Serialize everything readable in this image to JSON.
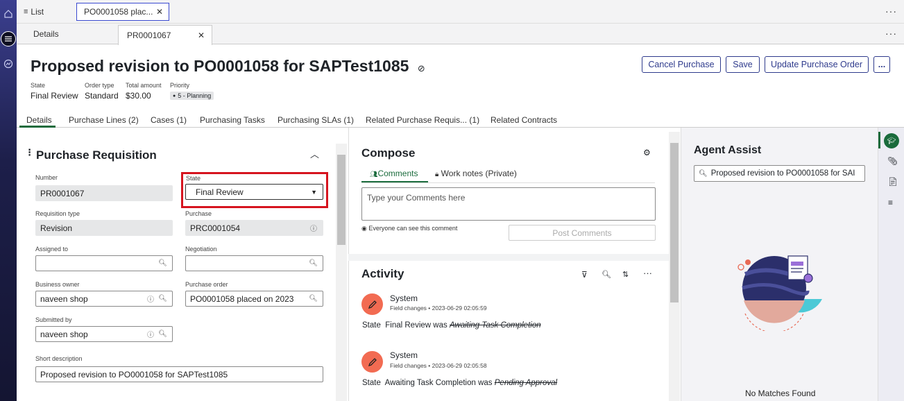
{
  "rail": {
    "icons": [
      "home-icon",
      "list-icon",
      "analytics-icon"
    ]
  },
  "top_tabs": {
    "list_label": "List",
    "record_tab": "PO0001058 plac..."
  },
  "sub_tabs": {
    "details": "Details",
    "record": "PR0001067"
  },
  "header": {
    "title": "Proposed revision to PO0001058 for SAPTest1085",
    "buttons": {
      "cancel": "Cancel Purchase",
      "save": "Save",
      "update": "Update Purchase Order",
      "more": "..."
    },
    "meta": [
      {
        "label": "State",
        "value": "Final Review"
      },
      {
        "label": "Order type",
        "value": "Standard"
      },
      {
        "label": "Total amount",
        "value": "$30.00"
      },
      {
        "label": "Priority",
        "value": "5 - Planning"
      }
    ]
  },
  "form_tabs": [
    "Details",
    "Purchase Lines (2)",
    "Cases (1)",
    "Purchasing Tasks",
    "Purchasing SLAs (1)",
    "Related Purchase Requis... (1)",
    "Related Contracts"
  ],
  "form": {
    "section_title": "Purchase Requisition",
    "number_label": "Number",
    "number": "PR0001067",
    "state_label": "State",
    "state": "Final Review",
    "req_type_label": "Requisition type",
    "req_type": "Revision",
    "purchase_label": "Purchase",
    "purchase": "PRC0001054",
    "assigned_label": "Assigned to",
    "assigned": "",
    "negotiation_label": "Negotiation",
    "negotiation": "",
    "owner_label": "Business owner",
    "owner": "naveen shop",
    "po_label": "Purchase order",
    "po": "PO0001058 placed on 2023",
    "submitted_label": "Submitted by",
    "submitted": "naveen shop",
    "short_desc_label": "Short description",
    "short_desc": "Proposed revision to PO0001058 for SAPTest1085"
  },
  "compose": {
    "title": "Compose",
    "tab_comments": "Comments",
    "tab_worknotes": "Work notes (Private)",
    "placeholder": "Type your Comments here",
    "visibility": "Everyone can see this comment",
    "post": "Post Comments"
  },
  "activity": {
    "title": "Activity",
    "entries": [
      {
        "author": "System",
        "meta": "Field changes • 2023-06-29 02:05:59",
        "field": "State",
        "new": "Final Review",
        "was": "was",
        "old": "Awaiting Task Completion"
      },
      {
        "author": "System",
        "meta": "Field changes • 2023-06-29 02:05:58",
        "field": "State",
        "new": "Awaiting Task Completion",
        "was": "was",
        "old": "Pending Approval"
      }
    ]
  },
  "agent_assist": {
    "title": "Agent Assist",
    "search_value": "Proposed revision to PO0001058 for SAI",
    "empty": "No Matches Found"
  },
  "colors": {
    "accent": "#2e3a8c",
    "highlight": "#d6141f",
    "tab_active": "#1a6b3c",
    "avatar": "#f26b52"
  }
}
